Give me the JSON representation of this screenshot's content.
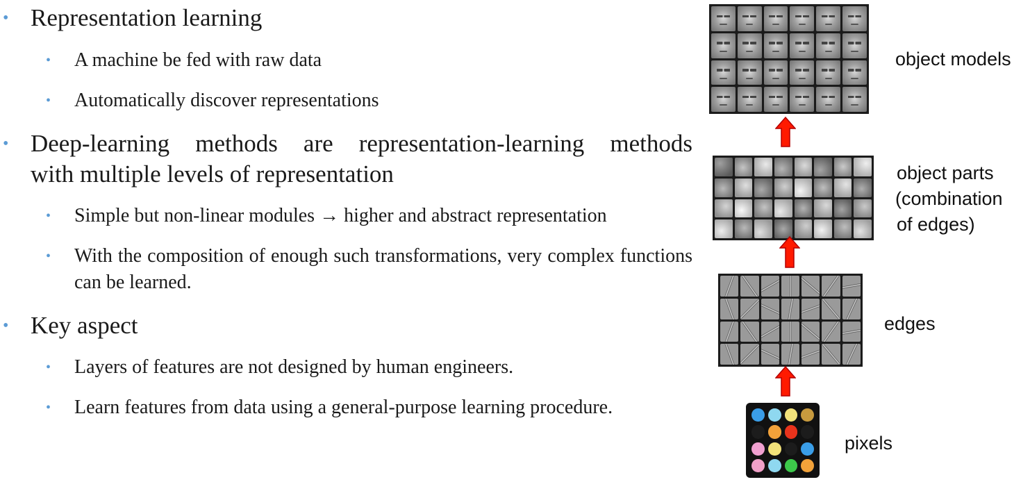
{
  "bullets": [
    {
      "text": "Representation learning",
      "subs": [
        "A machine be fed with raw data",
        "Automatically discover representations"
      ]
    },
    {
      "text_line1": "Deep-learning methods are representation-learning methods",
      "text_line2": "with multiple levels of representation",
      "subs": [
        "Simple but non-linear modules → higher and abstract representation",
        "With the composition of enough such transformations, very complex functions can be learned."
      ]
    },
    {
      "text": "Key aspect",
      "subs": [
        "Layers of features are not designed by human engineers.",
        "Learn features from data using a general-purpose learning procedure."
      ]
    }
  ],
  "bullet_glyph": "•",
  "diagram": {
    "labels": {
      "object_models": "object models",
      "object_parts_1": "object parts",
      "object_parts_2": "(combination",
      "object_parts_3": "of edges)",
      "edges": "edges",
      "pixels": "pixels"
    },
    "arrow_color": "#ff0000",
    "pixel_colors": [
      "#3a9ee8",
      "#8fd8f0",
      "#f2e27a",
      "#c79a3e",
      "#1c1c1c",
      "#f2a23a",
      "#e8331c",
      "#1c1c1c",
      "#f0a0d0",
      "#f2e27a",
      "#1c1c1c",
      "#3a9ee8",
      "#f0a0c8",
      "#8fd8f0",
      "#3cc84a",
      "#f2a23a"
    ]
  }
}
